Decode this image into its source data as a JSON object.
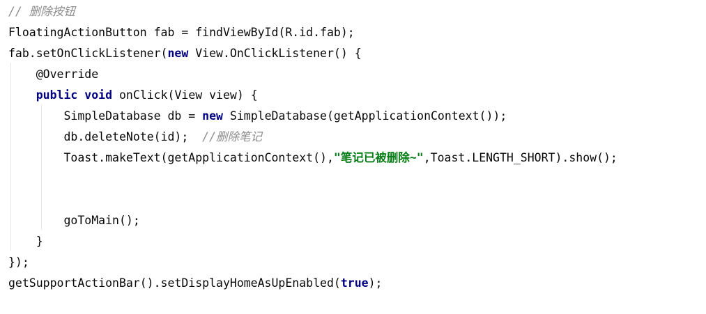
{
  "editor": {
    "lines": [
      {
        "indent": "",
        "parts": [
          {
            "t": "// 删除按钮",
            "c": "comment"
          }
        ]
      },
      {
        "indent": "",
        "parts": [
          {
            "t": "FloatingActionButton fab = findViewById(R.id.fab);",
            "c": "plain"
          }
        ]
      },
      {
        "indent": "",
        "parts": [
          {
            "t": "fab.setOnClickListener(",
            "c": "plain"
          },
          {
            "t": "new",
            "c": "kw"
          },
          {
            "t": " View.OnClickListener() {",
            "c": "plain"
          }
        ]
      },
      {
        "indent": "    ",
        "parts": [
          {
            "t": "@Override",
            "c": "anno"
          }
        ]
      },
      {
        "indent": "    ",
        "parts": [
          {
            "t": "public",
            "c": "kw"
          },
          {
            "t": " ",
            "c": "plain"
          },
          {
            "t": "void",
            "c": "kw"
          },
          {
            "t": " onClick(View view) {",
            "c": "plain"
          }
        ]
      },
      {
        "indent": "        ",
        "parts": [
          {
            "t": "SimpleDatabase db = ",
            "c": "plain"
          },
          {
            "t": "new",
            "c": "kw"
          },
          {
            "t": " SimpleDatabase(getApplicationContext());",
            "c": "plain"
          }
        ]
      },
      {
        "indent": "        ",
        "parts": [
          {
            "t": "db.deleteNote(id);  ",
            "c": "plain"
          },
          {
            "t": "//删除笔记",
            "c": "comment"
          }
        ]
      },
      {
        "indent": "        ",
        "parts": [
          {
            "t": "Toast.makeText(getApplicationContext(),",
            "c": "plain"
          },
          {
            "t": "\"笔记已被删除~\"",
            "c": "str"
          },
          {
            "t": ",Toast.LENGTH_SHORT).show();",
            "c": "plain"
          }
        ]
      },
      {
        "indent": "",
        "parts": []
      },
      {
        "indent": "",
        "parts": []
      },
      {
        "indent": "        ",
        "parts": [
          {
            "t": "goToMain();",
            "c": "plain"
          }
        ]
      },
      {
        "indent": "    ",
        "parts": [
          {
            "t": "}",
            "c": "plain"
          }
        ]
      },
      {
        "indent": "",
        "parts": [
          {
            "t": "});",
            "c": "plain"
          }
        ]
      },
      {
        "indent": "",
        "parts": [
          {
            "t": "getSupportActionBar().setDisplayHomeAsUpEnabled(",
            "c": "plain"
          },
          {
            "t": "true",
            "c": "kw"
          },
          {
            "t": ");",
            "c": "plain"
          }
        ]
      }
    ]
  }
}
